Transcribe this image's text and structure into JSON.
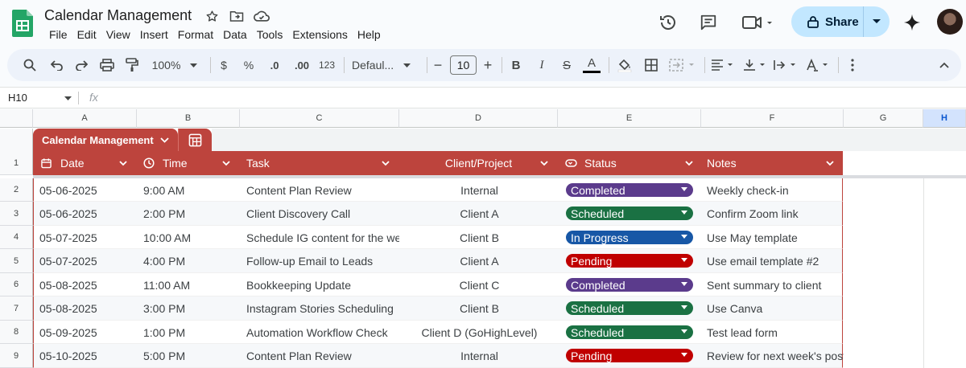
{
  "app": {
    "doc_title": "Calendar Management",
    "menu": [
      "File",
      "Edit",
      "View",
      "Insert",
      "Format",
      "Data",
      "Tools",
      "Extensions",
      "Help"
    ],
    "share_label": "Share"
  },
  "toolbar": {
    "zoom": "100%",
    "currency": "$",
    "percent": "%",
    "decrease_decimal": ".0",
    "increase_decimal": ".00",
    "number_format": "123",
    "font_family": "Defaul...",
    "font_size": "10",
    "bold": "B",
    "italic": "I",
    "strike": "S",
    "text_color": "A",
    "minus": "−",
    "plus": "+"
  },
  "formula_bar": {
    "cell_ref": "H10",
    "fx": "fx"
  },
  "columns": [
    "A",
    "B",
    "C",
    "D",
    "E",
    "F",
    "G",
    "H"
  ],
  "rows": [
    "1",
    "2",
    "3",
    "4",
    "5",
    "6",
    "7",
    "8",
    "9"
  ],
  "table": {
    "name": "Calendar Management",
    "headers": {
      "date": "Date",
      "time": "Time",
      "task": "Task",
      "client": "Client/Project",
      "status": "Status",
      "notes": "Notes"
    },
    "status_colors": {
      "Completed": "#5b3b8c",
      "Scheduled": "#1a7143",
      "In Progress": "#1757a6",
      "Pending": "#c00000"
    },
    "rows": [
      {
        "date": "05-06-2025",
        "time": "9:00 AM",
        "task": "Content Plan Review",
        "client": "Internal",
        "status": "Completed",
        "notes": "Weekly check-in"
      },
      {
        "date": "05-06-2025",
        "time": "2:00 PM",
        "task": "Client Discovery Call",
        "client": "Client A",
        "status": "Scheduled",
        "notes": "Confirm Zoom link"
      },
      {
        "date": "05-07-2025",
        "time": "10:00 AM",
        "task": "Schedule IG content for the week",
        "client": "Client B",
        "status": "In Progress",
        "notes": "Use May template"
      },
      {
        "date": "05-07-2025",
        "time": "4:00 PM",
        "task": " Follow-up Email to Leads",
        "client": "Client A",
        "status": "Pending",
        "notes": "Use email template #2"
      },
      {
        "date": "05-08-2025",
        "time": "11:00 AM",
        "task": " Bookkeeping Update",
        "client": "Client C",
        "status": "Completed",
        "notes": "Sent summary to client"
      },
      {
        "date": "05-08-2025",
        "time": "3:00 PM",
        "task": "Instagram Stories Scheduling",
        "client": "Client B",
        "status": "Scheduled",
        "notes": "Use Canva"
      },
      {
        "date": "05-09-2025",
        "time": "1:00 PM",
        "task": " Automation Workflow Check",
        "client": "Client D (GoHighLevel)",
        "status": "Scheduled",
        "notes": "Test lead form"
      },
      {
        "date": "05-10-2025",
        "time": "5:00 PM",
        "task": "Content Plan Review",
        "client": "Internal",
        "status": "Pending",
        "notes": "Review for next week's posts"
      }
    ]
  }
}
